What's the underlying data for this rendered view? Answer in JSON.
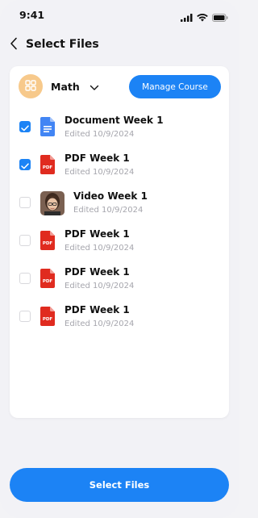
{
  "status_bar": {
    "time": "9:41"
  },
  "header": {
    "title": "Select Files"
  },
  "course": {
    "name": "Math",
    "manage_label": "Manage Course"
  },
  "files": [
    {
      "name": "Document Week 1",
      "date": "Edited 10/9/2024",
      "type": "doc",
      "checked": true,
      "icon": "google-doc-icon"
    },
    {
      "name": "PDF Week 1",
      "date": "Edited 10/9/2024",
      "type": "pdf",
      "checked": true,
      "icon": "pdf-file-icon"
    },
    {
      "name": "Video Week 1",
      "date": "Edited 10/9/2024",
      "type": "video",
      "checked": false,
      "icon": "video-thumbnail"
    },
    {
      "name": "PDF Week 1",
      "date": "Edited 10/9/2024",
      "type": "pdf",
      "checked": false,
      "icon": "pdf-file-icon"
    },
    {
      "name": "PDF Week 1",
      "date": "Edited 10/9/2024",
      "type": "pdf",
      "checked": false,
      "icon": "pdf-file-icon"
    },
    {
      "name": "PDF Week 1",
      "date": "Edited 10/9/2024",
      "type": "pdf",
      "checked": false,
      "icon": "pdf-file-icon"
    }
  ],
  "footer": {
    "select_label": "Select Files"
  },
  "colors": {
    "accent": "#1c83f5",
    "background": "#f2f2f6",
    "card": "#ffffff",
    "pdf_red": "#e02b1f",
    "doc_blue": "#4285f4",
    "course_avatar": "#f7c98b"
  }
}
